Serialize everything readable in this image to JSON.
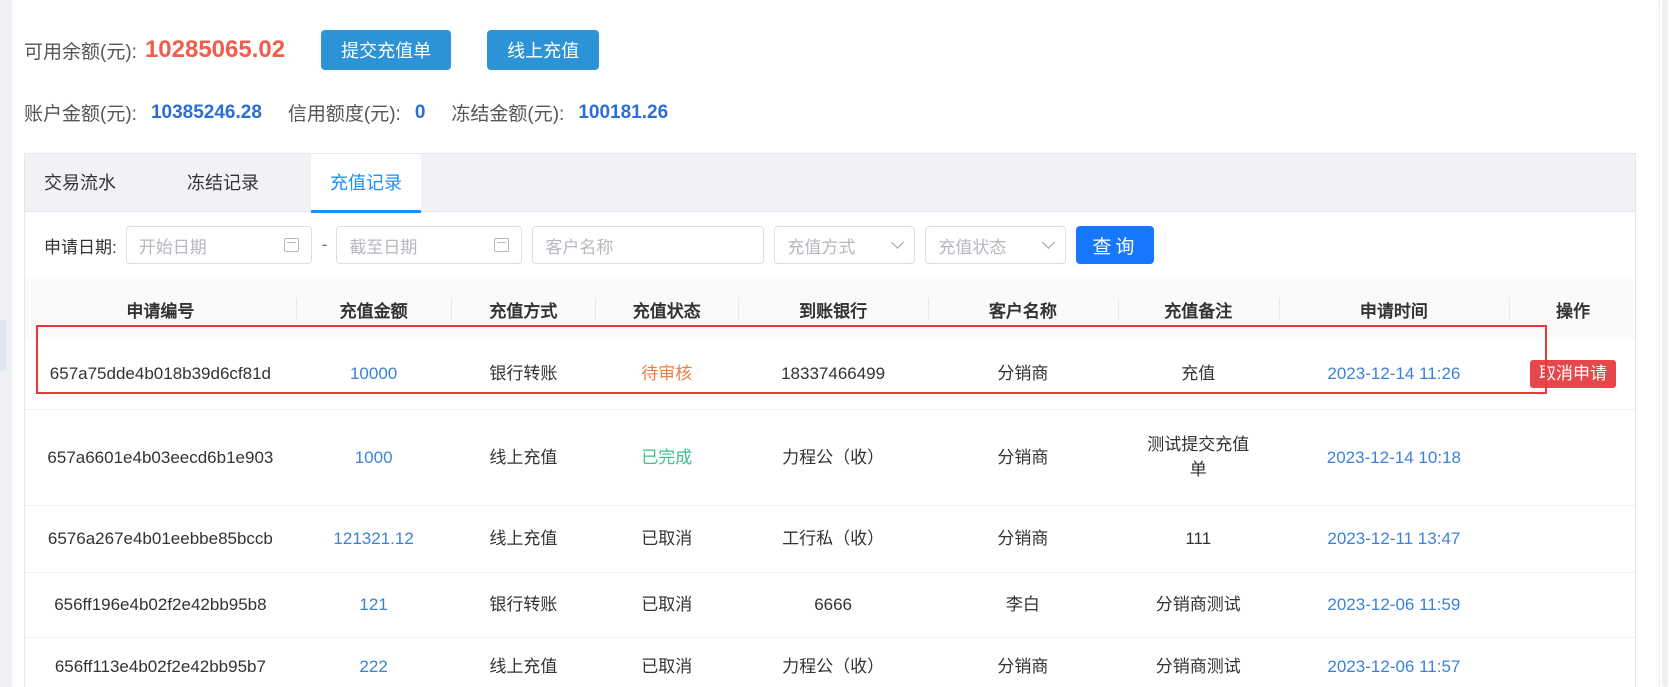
{
  "balance": {
    "available_label": "可用余额(元):",
    "available_value": "10285065.02",
    "submit_button": "提交充值单",
    "online_button": "线上充值",
    "account_label": "账户金额(元):",
    "account_value": "10385246.28",
    "credit_label": "信用额度(元):",
    "credit_value": "0",
    "frozen_label": "冻结金额(元):",
    "frozen_value": "100181.26"
  },
  "tabs": [
    {
      "label": "交易流水",
      "active": false
    },
    {
      "label": "冻结记录",
      "active": false
    },
    {
      "label": "充值记录",
      "active": true
    }
  ],
  "filters": {
    "date_label": "申请日期:",
    "start_placeholder": "开始日期",
    "separator": "-",
    "end_placeholder": "截至日期",
    "customer_placeholder": "客户名称",
    "method_placeholder": "充值方式",
    "status_placeholder": "充值状态",
    "query_button": "查询"
  },
  "table": {
    "headers": [
      "申请编号",
      "充值金额",
      "充值方式",
      "充值状态",
      "到账银行",
      "客户名称",
      "充值备注",
      "申请时间",
      "操作"
    ],
    "rows": [
      {
        "id": "657a75dde4b018b39d6cf81d",
        "amount": "10000",
        "method": "银行转账",
        "status": "待审核",
        "bank": "18337466499",
        "customer": "分销商",
        "note": "充值",
        "time": "2023-12-14 11:26",
        "action": "取消申请"
      },
      {
        "id": "657a6601e4b03eecd6b1e903",
        "amount": "1000",
        "method": "线上充值",
        "status": "已完成",
        "bank": "力程公（收）",
        "customer": "分销商",
        "note": "测试提交充值单",
        "time": "2023-12-14 10:18",
        "action": ""
      },
      {
        "id": "6576a267e4b01eebbe85bccb",
        "amount": "121321.12",
        "method": "线上充值",
        "status": "已取消",
        "bank": "工行私（收）",
        "customer": "分销商",
        "note": "111",
        "time": "2023-12-11 13:47",
        "action": ""
      },
      {
        "id": "656ff196e4b02f2e42bb95b8",
        "amount": "121",
        "method": "银行转账",
        "status": "已取消",
        "bank": "6666",
        "customer": "李白",
        "note": "分销商测试",
        "time": "2023-12-06 11:59",
        "action": ""
      },
      {
        "id": "656ff113e4b02f2e42bb95b7",
        "amount": "222",
        "method": "线上充值",
        "status": "已取消",
        "bank": "力程公（收）",
        "customer": "分销商",
        "note": "分销商测试",
        "time": "2023-12-06 11:57",
        "action": ""
      }
    ]
  }
}
